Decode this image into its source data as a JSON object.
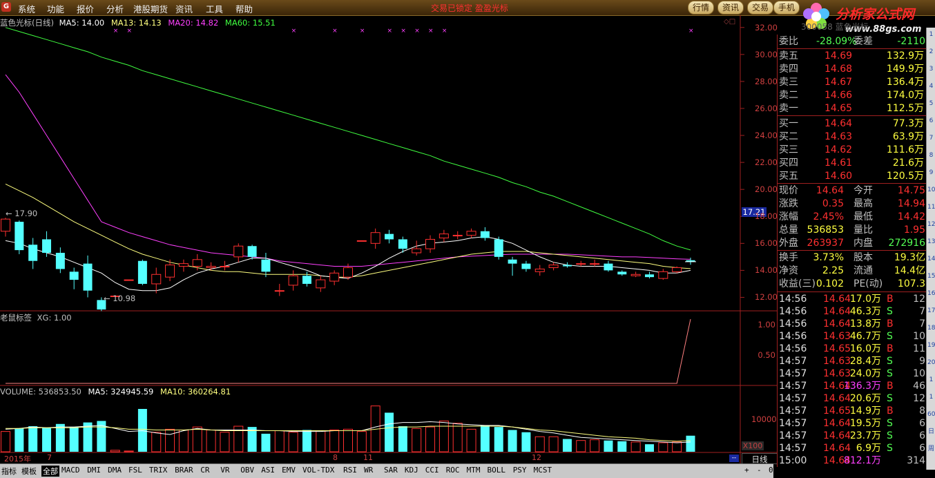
{
  "menu": {
    "items": [
      "系统",
      "功能",
      "报价",
      "分析",
      "港股期货",
      "资讯",
      "工具",
      "帮助"
    ],
    "marquee": "交易已锁定  盈盈光标",
    "tabs": [
      "行情",
      "资讯",
      "交易",
      "手机"
    ]
  },
  "brand": {
    "name": "分析家公式网",
    "url": "www.88gs.com"
  },
  "main_panel": {
    "title": "蓝色光标(日线)",
    "ma5": "MA5: 14.00",
    "ma13": "MA13: 14.13",
    "ma20": "MA20: 14.82",
    "ma60": "MA60: 15.51",
    "high_mark": "17.90",
    "low_mark": "10.98",
    "cursor_price": "17.21",
    "y_ticks": [
      "32.00",
      "30.00",
      "28.00",
      "26.00",
      "24.00",
      "22.00",
      "20.00",
      "18.00",
      "16.00",
      "14.00",
      "12.00"
    ]
  },
  "indicator_panel": {
    "title": "老鼠标签",
    "value": "XG: 1.00",
    "y_ticks": [
      "1.00",
      "0.50"
    ]
  },
  "volume_panel": {
    "title": "VOLUME: 536853.50",
    "ma5": "MA5: 324945.59",
    "ma10": "MA10: 360264.81",
    "y_tick": "10000",
    "multiplier": "X100"
  },
  "date_axis": {
    "labels": [
      "2015年",
      "7",
      "8",
      "11",
      "12"
    ],
    "period": "日线"
  },
  "bottom_tabs": [
    "指标",
    "模板",
    "全部",
    "MACD",
    "DMI",
    "DMA",
    "FSL",
    "TRIX",
    "BRAR",
    "CR",
    "VR",
    "OBV",
    "ASI",
    "EMV",
    "VOL-TDX",
    "RSI",
    "WR",
    "SAR",
    "KDJ",
    "CCI",
    "ROC",
    "MTM",
    "BOLL",
    "PSY",
    "MCST"
  ],
  "bottom_controls": [
    "+",
    "-",
    "0"
  ],
  "quote": {
    "header": "300058 蓝色光标",
    "webi": {
      "label": "委比",
      "value": "-28.09%",
      "label2": "委差",
      "value2": "-2110"
    },
    "asks": [
      {
        "label": "卖五",
        "price": "14.69",
        "vol": "132.9万"
      },
      {
        "label": "卖四",
        "price": "14.68",
        "vol": "149.9万"
      },
      {
        "label": "卖三",
        "price": "14.67",
        "vol": "136.4万"
      },
      {
        "label": "卖二",
        "price": "14.66",
        "vol": "174.0万"
      },
      {
        "label": "卖一",
        "price": "14.65",
        "vol": "112.5万"
      }
    ],
    "bids": [
      {
        "label": "买一",
        "price": "14.64",
        "vol": "77.3万"
      },
      {
        "label": "买二",
        "price": "14.63",
        "vol": "63.9万"
      },
      {
        "label": "买三",
        "price": "14.62",
        "vol": "111.6万"
      },
      {
        "label": "买四",
        "price": "14.61",
        "vol": "21.6万"
      },
      {
        "label": "买五",
        "price": "14.60",
        "vol": "120.5万"
      }
    ],
    "stats": [
      {
        "l1": "现价",
        "v1": "14.64",
        "l2": "今开",
        "v2": "14.75"
      },
      {
        "l1": "涨跌",
        "v1": "0.35",
        "l2": "最高",
        "v2": "14.94"
      },
      {
        "l1": "涨幅",
        "v1": "2.45%",
        "l2": "最低",
        "v2": "14.42"
      },
      {
        "l1": "总量",
        "v1": "536853",
        "l2": "量比",
        "v2": "1.95"
      },
      {
        "l1": "外盘",
        "v1": "263937",
        "l2": "内盘",
        "v2": "272916"
      }
    ],
    "stats2": [
      {
        "l1": "换手",
        "v1": "3.73%",
        "l2": "股本",
        "v2": "19.3亿"
      },
      {
        "l1": "净资",
        "v1": "2.25",
        "l2": "流通",
        "v2": "14.4亿"
      },
      {
        "l1": "收益(三)",
        "v1": "0.102",
        "l2": "PE(动)",
        "v2": "107.3"
      }
    ],
    "ticks": [
      {
        "t": "14:56",
        "p": "14.64",
        "v": "17.0万",
        "s": "B",
        "n": "12"
      },
      {
        "t": "14:56",
        "p": "14.64",
        "v": "46.3万",
        "s": "S",
        "n": "7"
      },
      {
        "t": "14:56",
        "p": "14.64",
        "v": "13.8万",
        "s": "B",
        "n": "7"
      },
      {
        "t": "14:56",
        "p": "14.63",
        "v": "46.7万",
        "s": "S",
        "n": "10"
      },
      {
        "t": "14:56",
        "p": "14.65",
        "v": "16.0万",
        "s": "B",
        "n": "11"
      },
      {
        "t": "14:57",
        "p": "14.63",
        "v": "28.4万",
        "s": "S",
        "n": "9"
      },
      {
        "t": "14:57",
        "p": "14.63",
        "v": "24.0万",
        "s": "S",
        "n": "10"
      },
      {
        "t": "14:57",
        "p": "14.64",
        "v": "136.3万",
        "s": "B",
        "n": "46"
      },
      {
        "t": "14:57",
        "p": "14.64",
        "v": "20.6万",
        "s": "S",
        "n": "12"
      },
      {
        "t": "14:57",
        "p": "14.65",
        "v": "14.9万",
        "s": "B",
        "n": "8"
      },
      {
        "t": "14:57",
        "p": "14.64",
        "v": "19.5万",
        "s": "S",
        "n": "6"
      },
      {
        "t": "14:57",
        "p": "14.64",
        "v": "23.7万",
        "s": "S",
        "n": "6"
      },
      {
        "t": "14:57",
        "p": "14.64",
        "v": "6.9万",
        "s": "S",
        "n": "6"
      },
      {
        "t": "15:00",
        "p": "14.64",
        "v": "812.1万",
        "s": "",
        "n": "314"
      }
    ]
  },
  "side_tools": [
    "1",
    "2",
    "3",
    "4",
    "5",
    "6",
    "7",
    "8",
    "9",
    "10",
    "11",
    "12",
    "13",
    "14",
    "15",
    "16",
    "17",
    "18",
    "19",
    "20",
    "1",
    "1",
    "60",
    "日",
    "周"
  ],
  "colors": {
    "up": "#ff3030",
    "down": "#54ffff",
    "ma5": "#ffffff",
    "ma13": "#ffff80",
    "ma20": "#ff40ff",
    "ma60": "#40ff40",
    "grid": "#a02020"
  },
  "chart_data": {
    "type": "candlestick",
    "ylim": [
      11,
      32.5
    ],
    "candles": [
      {
        "o": 16.9,
        "c": 17.8,
        "h": 17.9,
        "l": 16.5
      },
      {
        "o": 17.6,
        "c": 15.5,
        "h": 17.7,
        "l": 15.2
      },
      {
        "o": 15.9,
        "c": 14.7,
        "h": 16.4,
        "l": 14.1
      },
      {
        "o": 16.3,
        "c": 15.3,
        "h": 16.9,
        "l": 15.0
      },
      {
        "o": 15.3,
        "c": 14.1,
        "h": 15.7,
        "l": 13.8
      },
      {
        "o": 13.9,
        "c": 13.3,
        "h": 14.2,
        "l": 12.6
      },
      {
        "o": 14.5,
        "c": 12.5,
        "h": 15.1,
        "l": 12.0
      },
      {
        "o": 11.8,
        "c": 11.1,
        "h": 12.0,
        "l": 10.98
      },
      {
        "o": 12.1,
        "c": 12.1,
        "h": 12.1,
        "l": 12.1
      },
      {
        "o": 13.3,
        "c": 13.3,
        "h": 13.3,
        "l": 13.3
      },
      {
        "o": 14.7,
        "c": 13.0,
        "h": 14.8,
        "l": 12.9
      },
      {
        "o": 13.0,
        "c": 13.7,
        "h": 14.2,
        "l": 12.3
      },
      {
        "o": 13.5,
        "c": 14.4,
        "h": 14.8,
        "l": 13.2
      },
      {
        "o": 14.3,
        "c": 14.5,
        "h": 14.8,
        "l": 13.9
      },
      {
        "o": 14.3,
        "c": 14.8,
        "h": 15.2,
        "l": 14.0
      },
      {
        "o": 14.2,
        "c": 14.3,
        "h": 14.6,
        "l": 14.0
      },
      {
        "o": 14.3,
        "c": 14.3,
        "h": 14.7,
        "l": 14.0
      },
      {
        "o": 15.0,
        "c": 15.8,
        "h": 16.0,
        "l": 14.6
      },
      {
        "o": 15.8,
        "c": 15.0,
        "h": 15.9,
        "l": 14.8
      },
      {
        "o": 14.8,
        "c": 13.9,
        "h": 15.3,
        "l": 13.5
      },
      {
        "o": 12.5,
        "c": 12.5,
        "h": 13.0,
        "l": 12.1
      },
      {
        "o": 12.9,
        "c": 13.6,
        "h": 14.0,
        "l": 12.5
      },
      {
        "o": 13.6,
        "c": 13.0,
        "h": 13.9,
        "l": 12.8
      },
      {
        "o": 12.7,
        "c": 13.3,
        "h": 13.6,
        "l": 12.4
      },
      {
        "o": 13.2,
        "c": 13.8,
        "h": 14.0,
        "l": 12.9
      },
      {
        "o": 13.5,
        "c": 14.2,
        "h": 14.5,
        "l": 13.3
      },
      {
        "o": 16.2,
        "c": 16.2,
        "h": 16.2,
        "l": 16.2
      },
      {
        "o": 16.0,
        "c": 16.8,
        "h": 17.1,
        "l": 15.6
      },
      {
        "o": 16.7,
        "c": 16.3,
        "h": 17.0,
        "l": 16.0
      },
      {
        "o": 16.3,
        "c": 15.6,
        "h": 16.5,
        "l": 15.3
      },
      {
        "o": 15.3,
        "c": 15.6,
        "h": 16.2,
        "l": 15.1
      },
      {
        "o": 15.6,
        "c": 16.3,
        "h": 16.6,
        "l": 15.3
      },
      {
        "o": 16.4,
        "c": 16.7,
        "h": 17.0,
        "l": 16.1
      },
      {
        "o": 16.6,
        "c": 16.6,
        "h": 16.9,
        "l": 16.3
      },
      {
        "o": 16.6,
        "c": 16.9,
        "h": 17.1,
        "l": 16.4
      },
      {
        "o": 16.9,
        "c": 16.4,
        "h": 17.2,
        "l": 16.2
      },
      {
        "o": 16.3,
        "c": 15.0,
        "h": 16.5,
        "l": 14.8
      },
      {
        "o": 14.8,
        "c": 14.5,
        "h": 15.0,
        "l": 13.6
      },
      {
        "o": 14.5,
        "c": 14.1,
        "h": 14.7,
        "l": 13.9
      },
      {
        "o": 13.9,
        "c": 14.1,
        "h": 14.4,
        "l": 13.6
      },
      {
        "o": 14.2,
        "c": 14.4,
        "h": 14.6,
        "l": 14.0
      },
      {
        "o": 14.4,
        "c": 14.3,
        "h": 14.6,
        "l": 14.2
      },
      {
        "o": 14.5,
        "c": 14.5,
        "h": 14.7,
        "l": 14.3
      },
      {
        "o": 14.5,
        "c": 14.5,
        "h": 14.8,
        "l": 14.3
      },
      {
        "o": 14.5,
        "c": 14.0,
        "h": 14.7,
        "l": 13.9
      },
      {
        "o": 13.9,
        "c": 13.7,
        "h": 14.0,
        "l": 13.6
      },
      {
        "o": 13.6,
        "c": 13.7,
        "h": 13.9,
        "l": 13.5
      },
      {
        "o": 13.7,
        "c": 13.5,
        "h": 13.9,
        "l": 13.4
      },
      {
        "o": 13.4,
        "c": 13.9,
        "h": 14.1,
        "l": 13.3
      },
      {
        "o": 13.9,
        "c": 14.2,
        "h": 14.3,
        "l": 13.8
      },
      {
        "o": 14.75,
        "c": 14.64,
        "h": 14.94,
        "l": 14.42
      }
    ],
    "ma5": [
      16.2,
      16.0,
      15.6,
      15.3,
      15.0,
      14.6,
      14.2,
      13.8,
      13.1,
      12.6,
      12.5,
      12.5,
      12.7,
      13.3,
      13.8,
      14.1,
      14.3,
      14.6,
      14.9,
      14.9,
      14.6,
      14.3,
      14.0,
      13.6,
      13.5,
      13.4,
      13.8,
      14.3,
      14.9,
      15.4,
      15.8,
      16.0,
      16.1,
      16.2,
      16.4,
      16.5,
      16.3,
      16.0,
      15.5,
      15.0,
      14.6,
      14.4,
      14.3,
      14.3,
      14.3,
      14.2,
      14.1,
      14.0,
      13.8,
      13.8,
      14.0
    ],
    "ma13": [
      20.4,
      19.9,
      19.4,
      18.8,
      18.2,
      17.6,
      17.1,
      16.6,
      16.1,
      15.6,
      15.2,
      14.9,
      14.6,
      14.4,
      14.2,
      14.0,
      13.9,
      13.9,
      13.8,
      13.7,
      13.7,
      13.7,
      13.7,
      13.6,
      13.5,
      13.5,
      13.6,
      13.8,
      14.0,
      14.2,
      14.4,
      14.6,
      14.8,
      15.0,
      15.2,
      15.3,
      15.4,
      15.4,
      15.4,
      15.3,
      15.2,
      15.1,
      15.0,
      14.9,
      14.8,
      14.7,
      14.6,
      14.5,
      14.3,
      14.2,
      14.13
    ],
    "ma20": [
      28.5,
      27.2,
      25.6,
      24.0,
      22.4,
      20.8,
      19.2,
      17.6,
      17.2,
      16.8,
      16.5,
      16.2,
      15.9,
      15.7,
      15.5,
      15.3,
      15.2,
      15.1,
      15.0,
      14.9,
      14.7,
      14.6,
      14.5,
      14.4,
      14.3,
      14.3,
      14.3,
      14.4,
      14.5,
      14.6,
      14.7,
      14.8,
      14.9,
      15.0,
      15.05,
      15.1,
      15.15,
      15.2,
      15.2,
      15.2,
      15.2,
      15.2,
      15.15,
      15.1,
      15.05,
      15.0,
      15.0,
      14.95,
      14.9,
      14.85,
      14.82
    ],
    "ma60": [
      32.0,
      31.7,
      31.4,
      31.1,
      30.8,
      30.5,
      30.2,
      29.8,
      29.5,
      29.2,
      28.8,
      28.5,
      28.2,
      27.9,
      27.6,
      27.3,
      27.0,
      26.7,
      26.4,
      26.1,
      25.8,
      25.5,
      25.2,
      24.9,
      24.6,
      24.3,
      24.0,
      23.7,
      23.4,
      23.1,
      22.8,
      22.5,
      22.1,
      21.8,
      21.5,
      21.2,
      20.9,
      20.5,
      20.2,
      19.8,
      19.5,
      19.1,
      18.7,
      18.3,
      17.9,
      17.5,
      17.1,
      16.7,
      16.2,
      15.8,
      15.51
    ],
    "xg": [
      0,
      0,
      0,
      0,
      0,
      0,
      0,
      0,
      0,
      0,
      0,
      0,
      0,
      0,
      0,
      0,
      0,
      0,
      0,
      0,
      0,
      0,
      0,
      0,
      0,
      0,
      0,
      0,
      0,
      0,
      0,
      0,
      0,
      0,
      0,
      0,
      0,
      0,
      0,
      0,
      0,
      0,
      0,
      0,
      0,
      0,
      0,
      0,
      0,
      0,
      1
    ],
    "volume": [
      2700,
      3100,
      3400,
      3200,
      3700,
      3300,
      3900,
      4100,
      200,
      100,
      5700,
      2600,
      3000,
      2900,
      3300,
      2900,
      2600,
      3400,
      3300,
      2400,
      2800,
      2600,
      2900,
      2800,
      2900,
      3000,
      2700,
      6100,
      5200,
      3400,
      3100,
      3300,
      4100,
      3800,
      3000,
      3500,
      3300,
      2900,
      2600,
      2000,
      2000,
      1700,
      1500,
      1600,
      1500,
      1400,
      1300,
      1000,
      1200,
      1300,
      2138
    ],
    "vol_ma5": [
      3000,
      3100,
      3300,
      3200,
      3300,
      3300,
      3400,
      3500,
      3100,
      2700,
      2800,
      2500,
      2300,
      2800,
      3100,
      2900,
      2900,
      2900,
      2900,
      2800,
      2800,
      2700,
      2700,
      2700,
      2800,
      2800,
      2800,
      3300,
      3700,
      3900,
      3900,
      4000,
      3900,
      3700,
      3600,
      3500,
      3500,
      3300,
      3000,
      2700,
      2500,
      2200,
      1900,
      1800,
      1700,
      1600,
      1500,
      1400,
      1300,
      1200,
      1300
    ],
    "vol_ma10": [
      3100,
      3100,
      3200,
      3200,
      3200,
      3200,
      3300,
      3300,
      3200,
      3000,
      3000,
      2900,
      2900,
      2900,
      3000,
      2900,
      2800,
      2800,
      2800,
      2800,
      2800,
      2800,
      2800,
      2800,
      2800,
      2800,
      2800,
      3000,
      3200,
      3300,
      3300,
      3400,
      3400,
      3400,
      3400,
      3400,
      3400,
      3300,
      3100,
      2900,
      2800,
      2600,
      2400,
      2200,
      2000,
      1900,
      1800,
      1600,
      1500,
      1400,
      1500
    ],
    "vol_ylim": [
      0,
      8000
    ],
    "signals": [
      8,
      9,
      21,
      24,
      26,
      28,
      29,
      30,
      31,
      32,
      50
    ]
  }
}
